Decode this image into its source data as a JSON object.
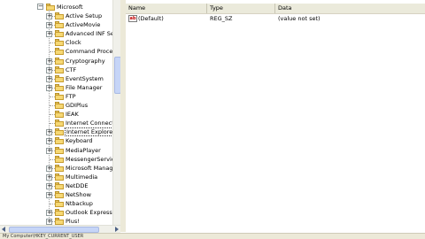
{
  "tree": {
    "root_label": "Microsoft",
    "items": [
      {
        "label": "Active Setup",
        "expandable": true
      },
      {
        "label": "ActiveMovie",
        "expandable": true
      },
      {
        "label": "Advanced INF Set",
        "expandable": true
      },
      {
        "label": "Clock",
        "expandable": false
      },
      {
        "label": "Command Process",
        "expandable": false
      },
      {
        "label": "Cryptography",
        "expandable": true
      },
      {
        "label": "CTF",
        "expandable": true
      },
      {
        "label": "EventSystem",
        "expandable": true
      },
      {
        "label": "File Manager",
        "expandable": true
      },
      {
        "label": "FTP",
        "expandable": false
      },
      {
        "label": "GDIPlus",
        "expandable": false
      },
      {
        "label": "IEAK",
        "expandable": false
      },
      {
        "label": "Internet Connect",
        "expandable": false
      },
      {
        "label": "Internet Explorer",
        "expandable": true,
        "selected": true
      },
      {
        "label": "Keyboard",
        "expandable": true
      },
      {
        "label": "MediaPlayer",
        "expandable": true
      },
      {
        "label": "MessengerService",
        "expandable": false
      },
      {
        "label": "Microsoft Manage",
        "expandable": true
      },
      {
        "label": "Multimedia",
        "expandable": true
      },
      {
        "label": "NetDDE",
        "expandable": true
      },
      {
        "label": "NetShow",
        "expandable": true
      },
      {
        "label": "Ntbackup",
        "expandable": false
      },
      {
        "label": "Outlook Express",
        "expandable": true
      },
      {
        "label": "Plus!",
        "expandable": true
      }
    ]
  },
  "list": {
    "columns": [
      "Name",
      "Type",
      "Data"
    ],
    "rows": [
      {
        "icon": "ab",
        "name": "(Default)",
        "type": "REG_SZ",
        "data": "(value not set)"
      }
    ]
  },
  "statusbar": {
    "text": "My Computer\\HKEY_CURRENT_USER"
  },
  "colors": {
    "folder": "#f6d874",
    "header": "#ebeadb",
    "chrome": "#ece9d8"
  }
}
